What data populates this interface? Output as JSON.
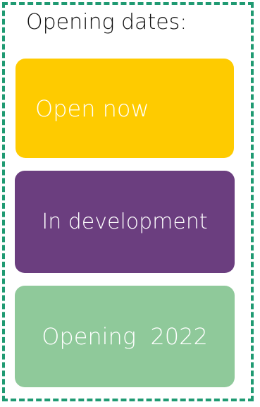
{
  "legend": {
    "title": "Opening dates:",
    "frame_color": "#1f9a72",
    "items": [
      {
        "label": "Open now",
        "color": "#fecb00"
      },
      {
        "label": "In development",
        "color": "#6b3e7f"
      },
      {
        "label": "Opening  2022",
        "color": "#8fc99a"
      }
    ]
  }
}
